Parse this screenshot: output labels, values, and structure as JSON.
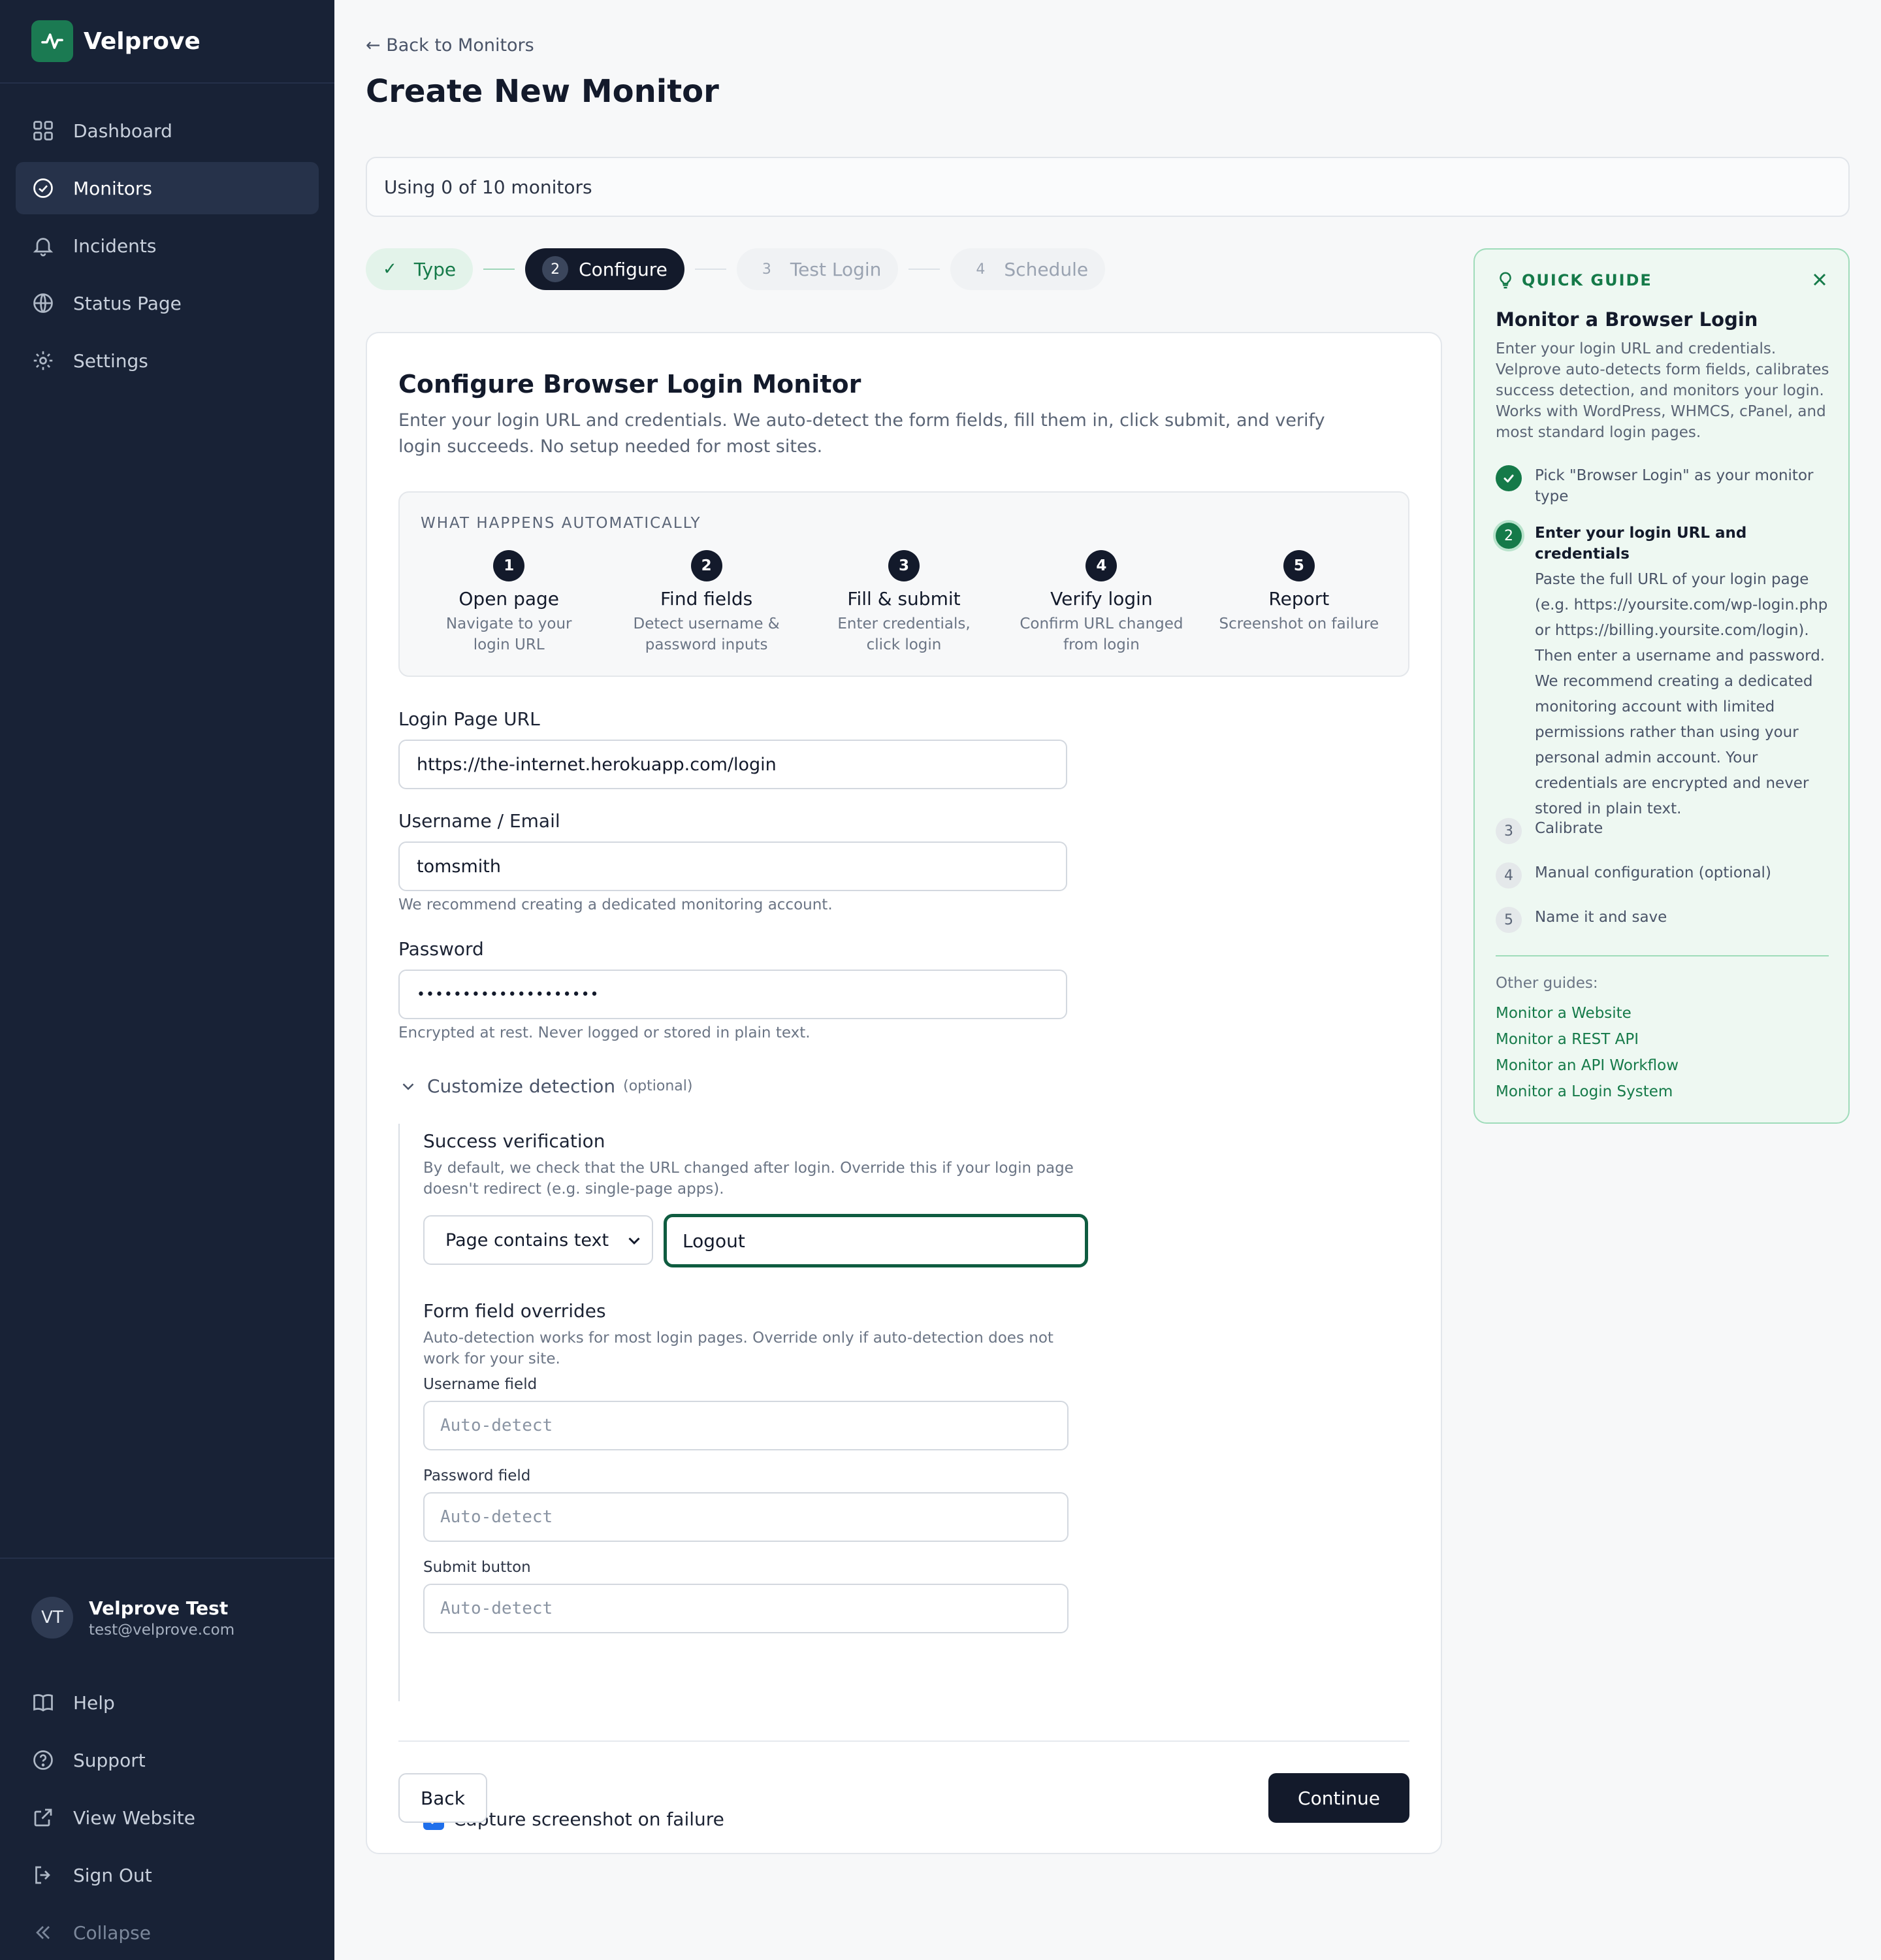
{
  "brand": {
    "name": "Velprove"
  },
  "sidebar": {
    "nav": [
      {
        "label": "Dashboard",
        "icon": "grid-icon"
      },
      {
        "label": "Monitors",
        "icon": "check-circle-icon",
        "active": true
      },
      {
        "label": "Incidents",
        "icon": "bell-icon"
      },
      {
        "label": "Status Page",
        "icon": "globe-icon"
      },
      {
        "label": "Settings",
        "icon": "gear-icon"
      }
    ],
    "user": {
      "initials": "VT",
      "name": "Velprove Test",
      "email": "test@velprove.com"
    },
    "footer": [
      {
        "label": "Help",
        "icon": "book-icon"
      },
      {
        "label": "Support",
        "icon": "help-circle-icon"
      },
      {
        "label": "View Website",
        "icon": "external-link-icon"
      },
      {
        "label": "Sign Out",
        "icon": "sign-out-icon"
      },
      {
        "label": "Collapse",
        "icon": "chevrons-left-icon"
      }
    ]
  },
  "header": {
    "back": "← Back to Monitors",
    "title": "Create New Monitor",
    "usage": "Using 0 of 10 monitors"
  },
  "stepper": [
    {
      "label": "Type",
      "state": "done"
    },
    {
      "num": "2",
      "label": "Configure",
      "state": "active"
    },
    {
      "num": "3",
      "label": "Test Login",
      "state": "pending"
    },
    {
      "num": "4",
      "label": "Schedule",
      "state": "pending"
    }
  ],
  "card": {
    "title": "Configure Browser Login Monitor",
    "description": "Enter your login URL and credentials. We auto-detect the form fields, fill them in, click submit, and verify login succeeds. No setup needed for most sites.",
    "auto": {
      "title": "WHAT HAPPENS AUTOMATICALLY",
      "steps": [
        {
          "num": "1",
          "name": "Open page",
          "desc": "Navigate to your login URL"
        },
        {
          "num": "2",
          "name": "Find fields",
          "desc": "Detect username & password inputs"
        },
        {
          "num": "3",
          "name": "Fill & submit",
          "desc": "Enter credentials, click login"
        },
        {
          "num": "4",
          "name": "Verify login",
          "desc": "Confirm URL changed from login"
        },
        {
          "num": "5",
          "name": "Report",
          "desc": "Screenshot on failure"
        }
      ]
    },
    "url": {
      "label": "Login Page URL",
      "value": "https://the-internet.herokuapp.com/login"
    },
    "username": {
      "label": "Username / Email",
      "value": "tomsmith",
      "hint": "We recommend creating a dedicated monitoring account."
    },
    "password": {
      "label": "Password",
      "value": "••••••••••••••••••••",
      "hint": "Encrypted at rest. Never logged or stored in plain text."
    },
    "customize": {
      "label": "Customize detection",
      "optional": "(optional)"
    },
    "success": {
      "title": "Success verification",
      "desc": "By default, we check that the URL changed after login. Override this if your login page doesn't redirect (e.g. single-page apps).",
      "method": "Page contains text",
      "text": "Logout"
    },
    "overrides": {
      "title": "Form field overrides",
      "desc": "Auto-detection works for most login pages. Override only if auto-detection does not work for your site.",
      "username_label": "Username field",
      "password_label": "Password field",
      "submit_label": "Submit button",
      "placeholder": "Auto-detect"
    },
    "screenshot": {
      "label": "Capture screenshot on failure",
      "checked": true
    },
    "back_button": "Back",
    "continue_button": "Continue"
  },
  "guide": {
    "heading": "QUICK GUIDE",
    "title": "Monitor a Browser Login",
    "desc": "Enter your login URL and credentials. Velprove auto-detects form fields, calibrates success detection, and monitors your login. Works with WordPress, WHMCS, cPanel, and most standard login pages.",
    "steps": [
      {
        "label": "Pick \"Browser Login\" as your monitor type",
        "state": "done"
      },
      {
        "num": "2",
        "label": "Enter your login URL and credentials",
        "state": "current",
        "body": "Paste the full URL of your login page (e.g. https://yoursite.com/wp-login.php or https://billing.yoursite.com/login). Then enter a username and password. We recommend creating a dedicated monitoring account with limited permissions rather than using your personal admin account. Your credentials are encrypted and never stored in plain text."
      },
      {
        "num": "3",
        "label": "Calibrate",
        "state": "todo"
      },
      {
        "num": "4",
        "label": "Manual configuration (optional)",
        "state": "todo"
      },
      {
        "num": "5",
        "label": "Name it and save",
        "state": "todo"
      }
    ],
    "other_label": "Other guides:",
    "links": [
      "Monitor a Website",
      "Monitor a REST API",
      "Monitor an API Workflow",
      "Monitor a Login System"
    ]
  },
  "colors": {
    "sidebar": "#182236",
    "accent": "#157a49",
    "primary": "#131a2b"
  }
}
